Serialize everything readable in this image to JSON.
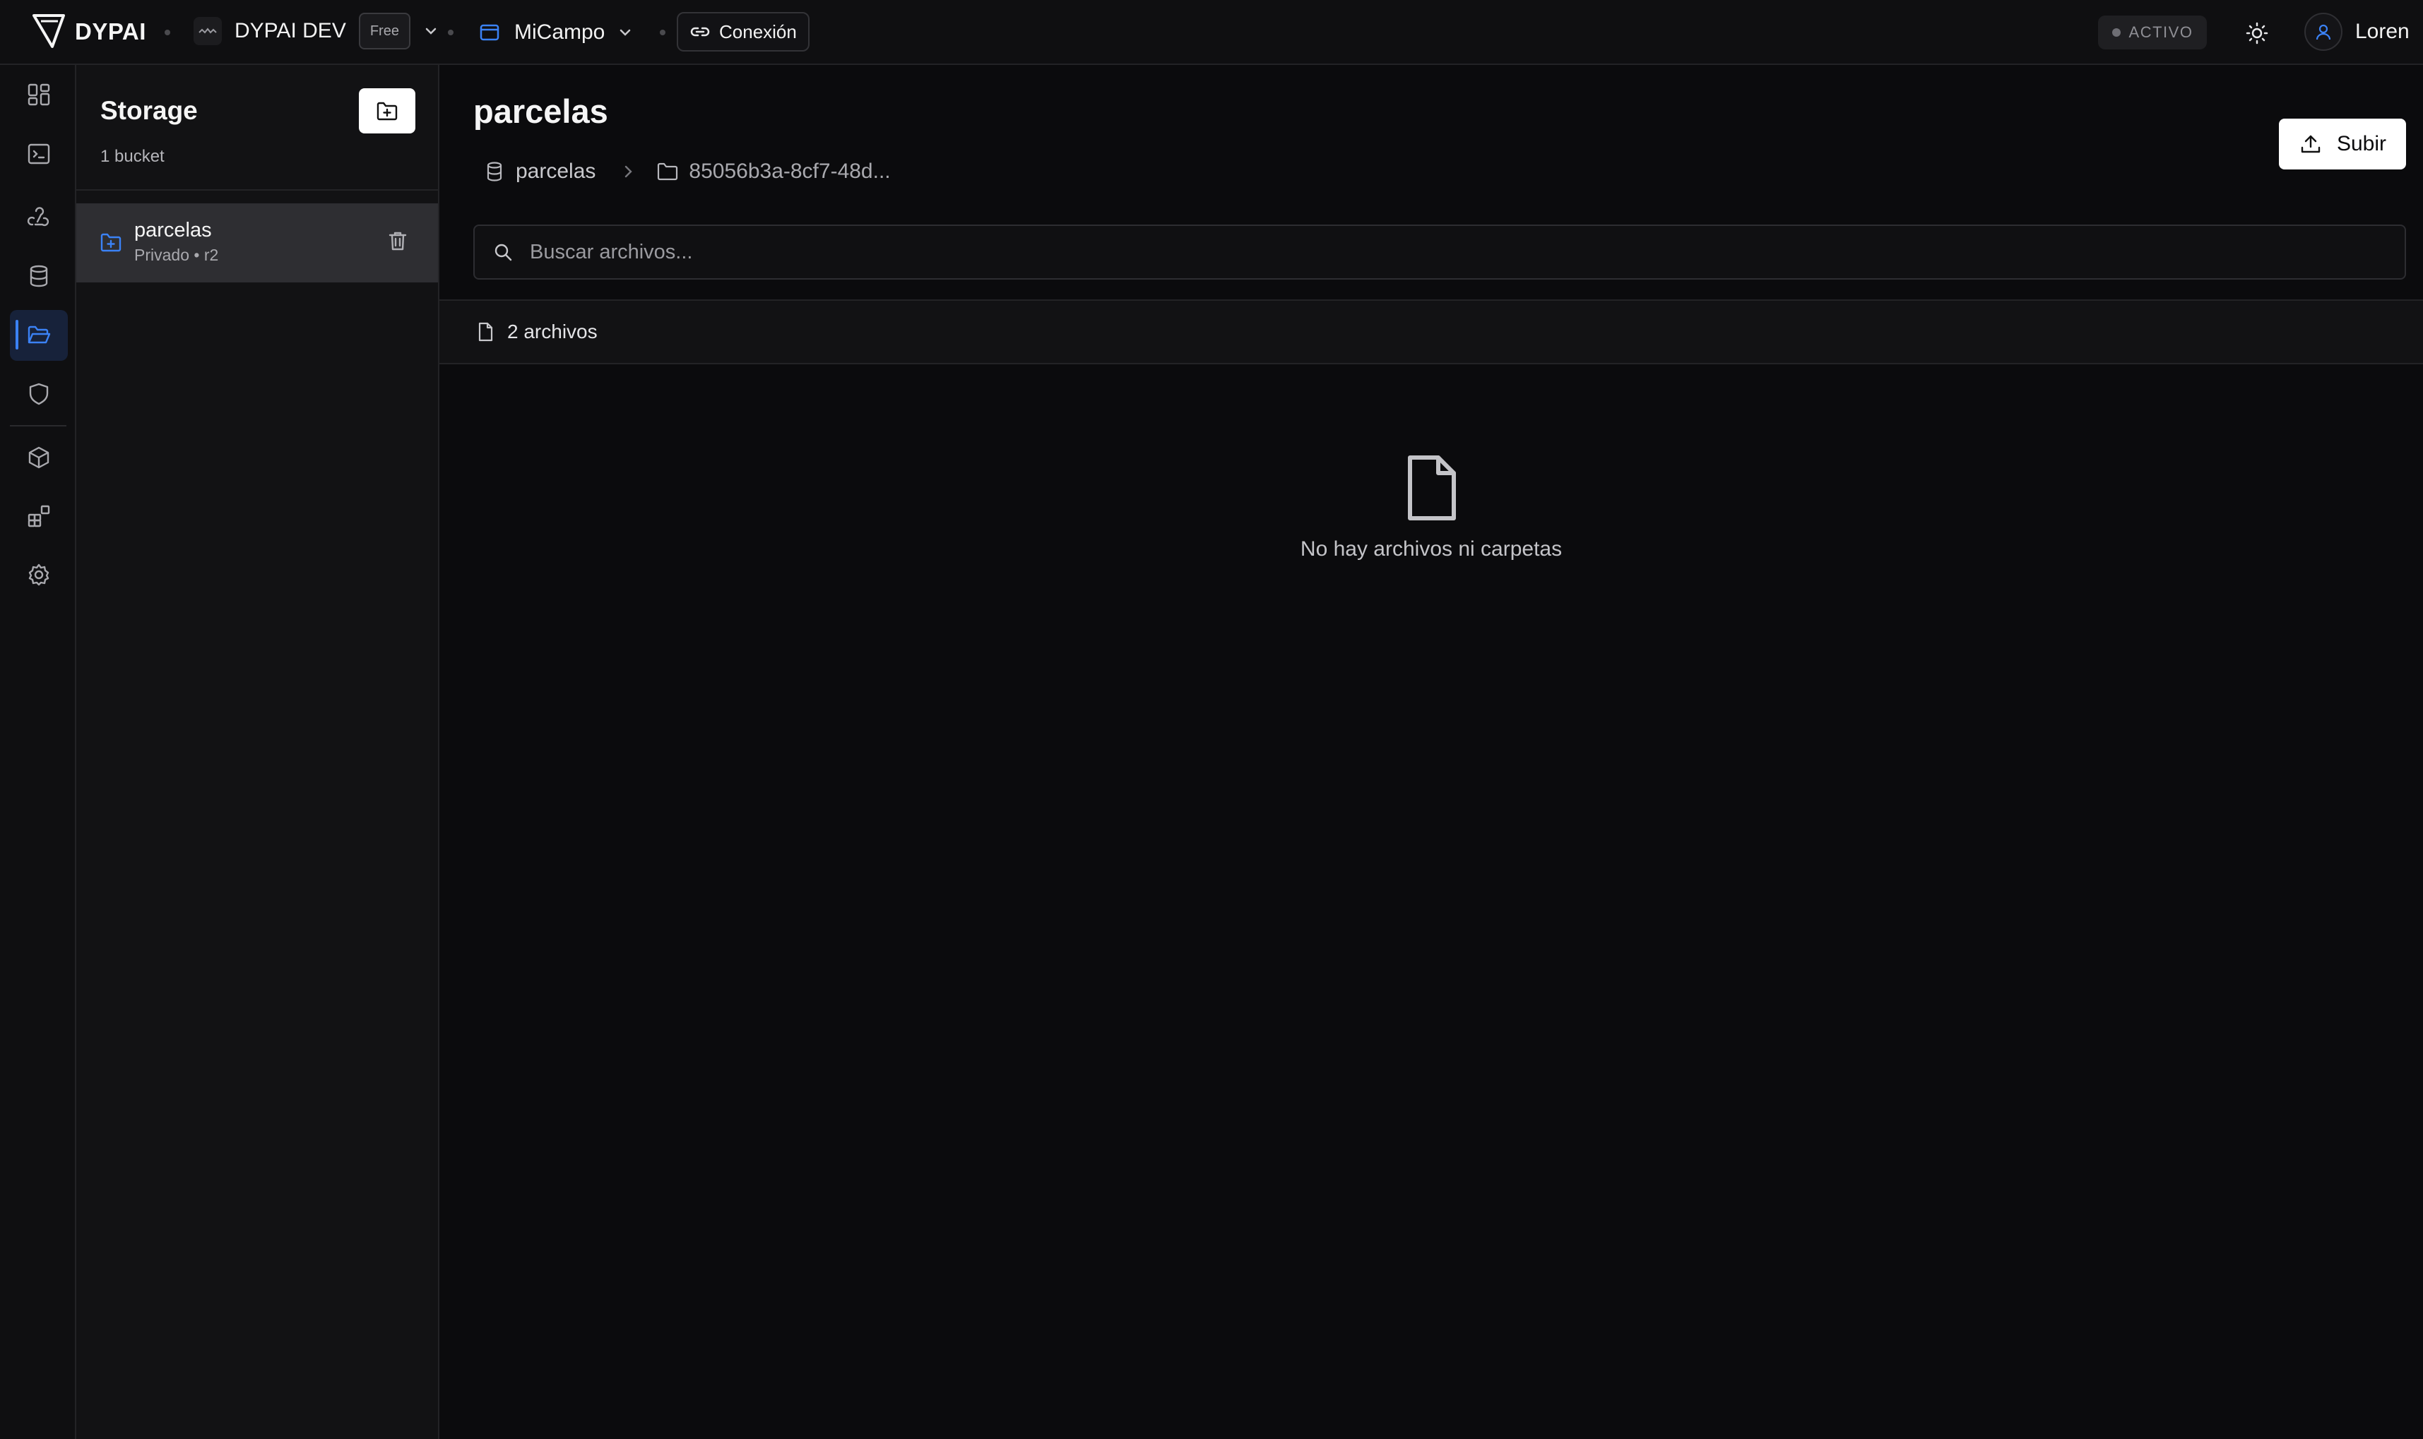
{
  "topbar": {
    "logo_text": "DYPAI",
    "org": {
      "name": "DYPAI DEV",
      "plan_badge": "Free"
    },
    "project": {
      "name": "MiCampo"
    },
    "connection_label": "Conexión",
    "status_label": "ACTIVO",
    "user_name": "Loren"
  },
  "rail": {
    "icons": [
      "dashboard-icon",
      "terminal-icon",
      "webhook-icon",
      "database-icon",
      "folder-open-icon",
      "shield-icon",
      "package-icon",
      "blocks-icon",
      "settings-icon"
    ],
    "active": "folder-open-icon"
  },
  "storage_panel": {
    "title": "Storage",
    "subtitle": "1 bucket",
    "buckets": [
      {
        "name": "parcelas",
        "meta": "Privado • r2",
        "selected": true
      }
    ]
  },
  "main": {
    "title": "parcelas",
    "upload_label": "Subir",
    "breadcrumb": {
      "bucket": "parcelas",
      "folder": "85056b3a-8cf7-48d..."
    },
    "search_placeholder": "Buscar archivos...",
    "file_count": "2 archivos",
    "empty_message": "No hay archivos ni carpetas"
  },
  "colors": {
    "accent": "#3b82f6",
    "background": "#0b0b0d",
    "panel": "#121214",
    "selected_item": "#2e2e32"
  }
}
